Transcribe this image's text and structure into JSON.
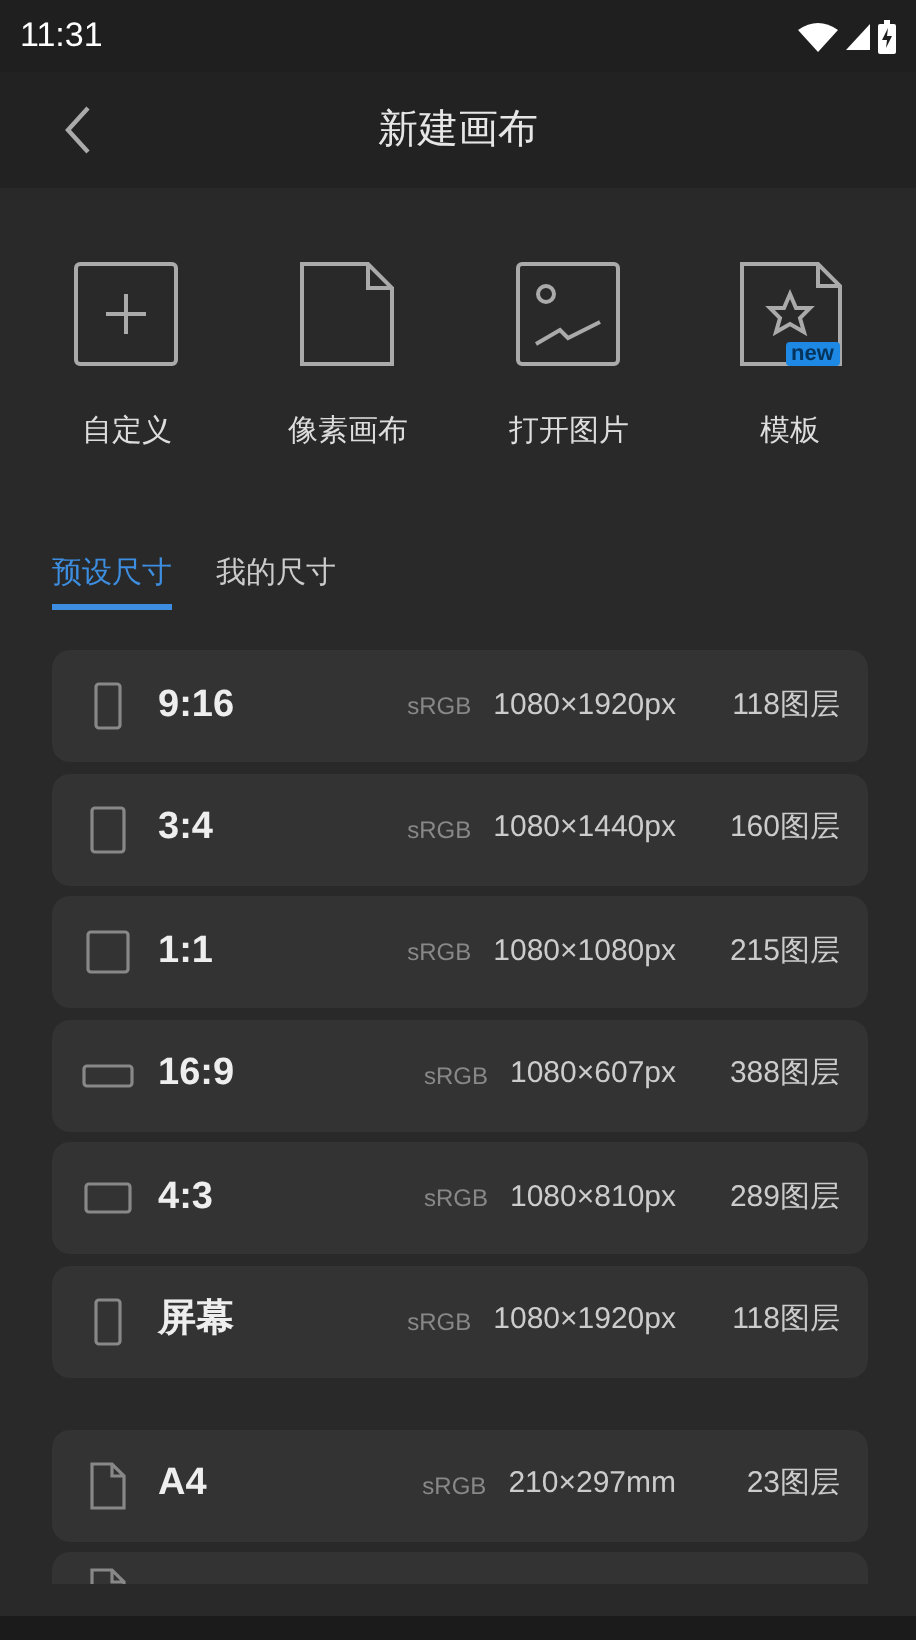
{
  "status_bar": {
    "time": "11:31"
  },
  "header": {
    "title": "新建画布"
  },
  "actions": [
    {
      "kind": "plus",
      "label": "自定义"
    },
    {
      "kind": "file",
      "label": "像素画布"
    },
    {
      "kind": "image",
      "label": "打开图片"
    },
    {
      "kind": "template",
      "label": "模板",
      "badge": "new"
    }
  ],
  "tabs": [
    {
      "label": "预设尺寸",
      "selected": true
    },
    {
      "label": "我的尺寸",
      "selected": false
    }
  ],
  "groups": [
    {
      "presets": [
        {
          "kind": "tall",
          "name": "9:16",
          "color_space": "sRGB",
          "size": "1080×1920px",
          "layers": "118图层"
        },
        {
          "kind": "portrait",
          "name": "3:4",
          "color_space": "sRGB",
          "size": "1080×1440px",
          "layers": "160图层"
        },
        {
          "kind": "square",
          "name": "1:1",
          "color_space": "sRGB",
          "size": "1080×1080px",
          "layers": "215图层"
        },
        {
          "kind": "wide",
          "name": "16:9",
          "color_space": "sRGB",
          "size": "1080×607px",
          "layers": "388图层"
        },
        {
          "kind": "landscape",
          "name": "4:3",
          "color_space": "sRGB",
          "size": "1080×810px",
          "layers": "289图层"
        },
        {
          "kind": "tall",
          "name": "屏幕",
          "color_space": "sRGB",
          "size": "1080×1920px",
          "layers": "118图层"
        }
      ]
    },
    {
      "presets": [
        {
          "kind": "paper",
          "name": "A4",
          "color_space": "sRGB",
          "size": "210×297mm",
          "layers": "23图层"
        },
        {
          "kind": "paper"
        }
      ]
    }
  ]
}
